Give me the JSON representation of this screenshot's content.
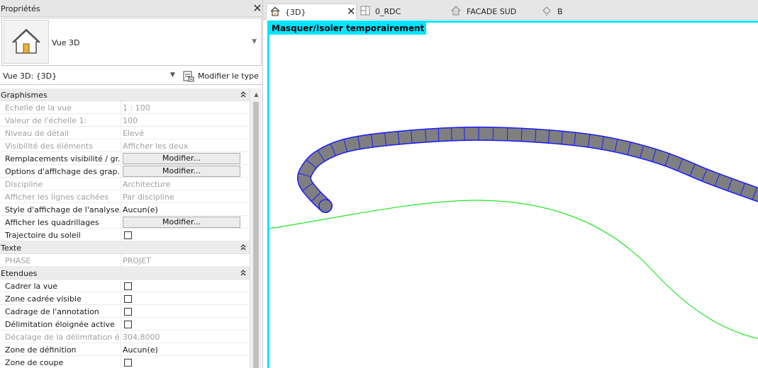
{
  "properties": {
    "title": "Propriétés",
    "type_selector": {
      "name": "Vue 3D"
    },
    "instance": {
      "label": "Vue 3D: {3D}",
      "edit_type": "Modifier le type"
    },
    "groups": [
      {
        "label": "Graphismes",
        "rows": [
          {
            "name": "Echelle de la vue",
            "value": "1 : 100",
            "kind": "text",
            "dim": true
          },
          {
            "name": "Valeur de l'échelle    1:",
            "value": "100",
            "kind": "text",
            "dim": true
          },
          {
            "name": "Niveau de détail",
            "value": "Elevé",
            "kind": "text",
            "dim": true
          },
          {
            "name": "Visibilité des éléments",
            "value": "Afficher les deux",
            "kind": "text",
            "dim": true
          },
          {
            "name": "Remplacements visibilité / gr...",
            "value": "Modifier...",
            "kind": "button",
            "dim": false
          },
          {
            "name": "Options d'affichage des grap...",
            "value": "Modifier...",
            "kind": "button",
            "dim": false
          },
          {
            "name": "Discipline",
            "value": "Architecture",
            "kind": "text",
            "dim": true
          },
          {
            "name": "Afficher les lignes cachées",
            "value": "Par discipline",
            "kind": "text",
            "dim": true
          },
          {
            "name": "Style d'affichage de l'analyse...",
            "value": "Aucun(e)",
            "kind": "text",
            "dim": false
          },
          {
            "name": "Afficher les quadrillages",
            "value": "Modifier...",
            "kind": "button",
            "dim": false
          },
          {
            "name": "Trajectoire du soleil",
            "value": "",
            "kind": "checkbox",
            "dim": false
          }
        ]
      },
      {
        "label": "Texte",
        "rows": [
          {
            "name": "PHASE",
            "value": "PROJET",
            "kind": "text",
            "dim": true
          }
        ]
      },
      {
        "label": "Etendues",
        "rows": [
          {
            "name": "Cadrer la vue",
            "value": "",
            "kind": "checkbox",
            "dim": false
          },
          {
            "name": "Zone cadrée visible",
            "value": "",
            "kind": "checkbox",
            "dim": false
          },
          {
            "name": "Cadrage de l'annotation",
            "value": "",
            "kind": "checkbox",
            "dim": false
          },
          {
            "name": "Délimitation éloignée active",
            "value": "",
            "kind": "checkbox",
            "dim": false
          },
          {
            "name": "Décalage de la délimitation é...",
            "value": "304,8000",
            "kind": "text",
            "dim": true
          },
          {
            "name": "Zone de définition",
            "value": "Aucun(e)",
            "kind": "text",
            "dim": false
          },
          {
            "name": "Zone de coupe",
            "value": "",
            "kind": "checkbox",
            "dim": false
          }
        ]
      }
    ]
  },
  "tabs": [
    {
      "label": "{3D}",
      "icon": "house-icon",
      "active": true,
      "closable": true
    },
    {
      "label": "0_RDC",
      "icon": "floor-plan-icon",
      "active": false,
      "closable": false
    },
    {
      "label": "FACADE SUD",
      "icon": "elevation-icon",
      "active": false,
      "closable": false
    },
    {
      "label": "B",
      "icon": "section-icon",
      "active": false,
      "closable": false
    }
  ],
  "viewport": {
    "banner": "Masquer/Isoler temporairement",
    "colors": {
      "border": "#00e5ff",
      "pipe_fill": "#7f7f7f",
      "pipe_stroke": "#1a1aff",
      "curve": "#22e622"
    }
  }
}
